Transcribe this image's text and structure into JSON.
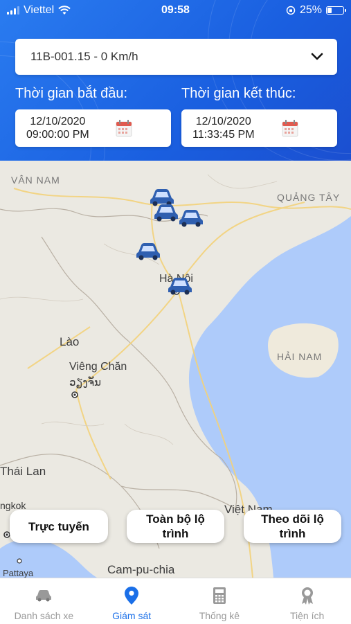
{
  "status_bar": {
    "carrier": "Viettel",
    "time": "09:58",
    "battery": "25%",
    "battery_level": 0.25
  },
  "vehicle_select": {
    "value": "11B-001.15 - 0 Km/h"
  },
  "start_time": {
    "label": "Thời gian bắt đầu:",
    "date": "12/10/2020",
    "time": "09:00:00 PM"
  },
  "end_time": {
    "label": "Thời gian kết thúc:",
    "date": "12/10/2020",
    "time": "11:33:45 PM"
  },
  "map": {
    "places": {
      "van_nam": "VÂN NAM",
      "quang_tay": "QUẢNG TÂY",
      "ha_noi": "Hà Nội",
      "lao": "Lào",
      "vieng_chan": "Viêng Chăn",
      "vieng_chan_lao": "ວຽງຈັນ",
      "hai_nam": "HẢI NAM",
      "thai_lan": "Thái Lan",
      "bangkok": "ngkok",
      "viet_nam": "Việt Nam",
      "pattaya": "Pattaya",
      "campuchia": "Cam-pu-chia"
    },
    "accent": "#2f5fb0"
  },
  "actions": {
    "online": "Trực tuyến",
    "full_route_line1": "Toàn bộ lộ",
    "full_route_line2": "trình",
    "track_route_line1": "Theo dõi lộ",
    "track_route_line2": "trình"
  },
  "tabs": {
    "vehicles": "Danh sách xe",
    "monitor": "Giám sát",
    "stats": "Thống kê",
    "utilities": "Tiện ích"
  },
  "colors": {
    "primary": "#1a6fe8",
    "header": "#1f63e6",
    "calendar": "#e05a4f"
  }
}
